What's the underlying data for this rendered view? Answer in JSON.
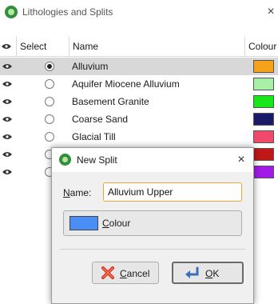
{
  "window": {
    "title": "Lithologies and Splits",
    "close_glyph": "×"
  },
  "table": {
    "columns": [
      "Select",
      "Name",
      "Colour"
    ],
    "eye_header_icon": "eye-icon",
    "rows": [
      {
        "name": "Alluvium",
        "colour": "#f6a21a",
        "selected": true
      },
      {
        "name": "Aquifer Miocene Alluvium",
        "colour": "#a8f0a8",
        "selected": false
      },
      {
        "name": "Basement Granite",
        "colour": "#19e619",
        "selected": false
      },
      {
        "name": "Coarse Sand",
        "colour": "#1a1a66",
        "selected": false
      },
      {
        "name": "Glacial Till",
        "colour": "#f04a6a",
        "selected": false
      },
      {
        "name": "",
        "colour": "#c01818",
        "selected": false
      },
      {
        "name": "",
        "colour": "#a21ae6",
        "selected": false
      }
    ]
  },
  "dialog": {
    "title": "New Split",
    "close_glyph": "×",
    "name_label_first": "N",
    "name_label_rest": "ame:",
    "name_value": "Alluvium Upper",
    "colour_label_first": "C",
    "colour_label_rest": "olour",
    "colour_value": "#4a8ff5",
    "cancel_first": "C",
    "cancel_rest": "ancel",
    "ok_first": "O",
    "ok_rest": "K"
  }
}
